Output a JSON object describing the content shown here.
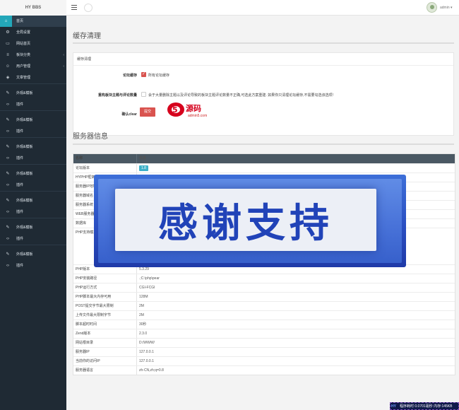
{
  "header": {
    "logo": "HY BBS",
    "user": "admin ▾"
  },
  "sidebar": {
    "items": [
      {
        "icon": "home-icon",
        "glyph": "⌂",
        "label": "首页",
        "arrow": ""
      },
      {
        "icon": "gear-icon",
        "glyph": "⚙",
        "label": "全局设置",
        "arrow": ""
      },
      {
        "icon": "monitor-icon",
        "glyph": "▭",
        "label": "网站首页",
        "arrow": ""
      },
      {
        "icon": "list-icon",
        "glyph": "≡",
        "label": "板块分类",
        "arrow": "‹"
      },
      {
        "icon": "users-icon",
        "glyph": "☺",
        "label": "用户管理",
        "arrow": "‹"
      },
      {
        "icon": "tag-icon",
        "glyph": "◈",
        "label": "文章管理",
        "arrow": ""
      },
      {
        "icon": "brush-icon",
        "glyph": "✎",
        "label": "外观&模板",
        "arrow": ""
      },
      {
        "icon": "code-icon",
        "glyph": "‹›",
        "label": "插件",
        "arrow": ""
      },
      {
        "icon": "brush-icon",
        "glyph": "✎",
        "label": "外观&模板",
        "arrow": ""
      },
      {
        "icon": "code-icon",
        "glyph": "‹›",
        "label": "插件",
        "arrow": ""
      },
      {
        "icon": "brush-icon",
        "glyph": "✎",
        "label": "外观&模板",
        "arrow": ""
      },
      {
        "icon": "code-icon",
        "glyph": "‹›",
        "label": "插件",
        "arrow": ""
      },
      {
        "icon": "brush-icon",
        "glyph": "✎",
        "label": "外观&模板",
        "arrow": ""
      },
      {
        "icon": "code-icon",
        "glyph": "‹›",
        "label": "插件",
        "arrow": ""
      },
      {
        "icon": "brush-icon",
        "glyph": "✎",
        "label": "外观&模板",
        "arrow": ""
      },
      {
        "icon": "code-icon",
        "glyph": "‹›",
        "label": "插件",
        "arrow": ""
      },
      {
        "icon": "brush-icon",
        "glyph": "✎",
        "label": "外观&模板",
        "arrow": ""
      },
      {
        "icon": "code-icon",
        "glyph": "‹›",
        "label": "插件",
        "arrow": ""
      },
      {
        "icon": "brush-icon",
        "glyph": "✎",
        "label": "外观&模板",
        "arrow": ""
      },
      {
        "icon": "code-icon",
        "glyph": "‹›",
        "label": "插件",
        "arrow": ""
      }
    ]
  },
  "cache": {
    "title": "缓存清理",
    "panel_title": "缓存清理",
    "row1_label": "论坛缓存",
    "row1_option": "所有论坛缓存",
    "row2_label": "重构板块主题与评论数量",
    "row2_option": "会于大量删除主题以及评论导致的板块主题评论数量不正确,可选此方案重建. 如果你只清理论坛缓存,不需要勾选该选项!",
    "row3_label": "确认clear",
    "submit": "提交",
    "watermark": "源码",
    "watermark_sub": "admin5.com"
  },
  "server": {
    "title": "服务器信息",
    "col_name": "名称",
    "col_info": "信息",
    "rows": [
      {
        "name": "论坛版本",
        "value": "1.8"
      },
      {
        "name": "HYPHP框架",
        "value": ""
      },
      {
        "name": "服务器IP地址",
        "value": ""
      },
      {
        "name": "服务器域名",
        "value": ""
      },
      {
        "name": "服务器系统",
        "value": ""
      },
      {
        "name": "WEB服务器",
        "value": ""
      },
      {
        "name": "数据库",
        "value": ""
      },
      {
        "name": "PHP支持模块",
        "value": ""
      },
      {
        "name": "PHP版本",
        "value": "5.3.29"
      },
      {
        "name": "PHP安装路径",
        "value": ".;C:\\php\\pear"
      },
      {
        "name": "PHP运行方式",
        "value": "CGI-FCGI"
      },
      {
        "name": "PHP脚本最大内存可用",
        "value": "128M"
      },
      {
        "name": "POST提交字节最大限制",
        "value": "2M"
      },
      {
        "name": "上传文件最大限制字节",
        "value": "2M"
      },
      {
        "name": "脚本超时时间",
        "value": "30秒"
      },
      {
        "name": "Zend版本",
        "value": "2.3.0"
      },
      {
        "name": "网站根目录",
        "value": "D:/WWW/"
      },
      {
        "name": "服务器IP",
        "value": "127.0.0.1"
      },
      {
        "name": "当前你的访问IP",
        "value": "127.0.0.1"
      },
      {
        "name": "服务器语言",
        "value": "zh-CN,zh;q=0.8"
      }
    ]
  },
  "overlay": {
    "text": "感谢支持"
  },
  "footer": {
    "hy": "HY",
    "text": "程序耗时 0.0701毫秒 内存:145KB"
  },
  "colors": {
    "sidebar": "#1f2a34",
    "accent": "#23a7b9",
    "danger": "#d9534f",
    "table_head": "#4a5863"
  }
}
